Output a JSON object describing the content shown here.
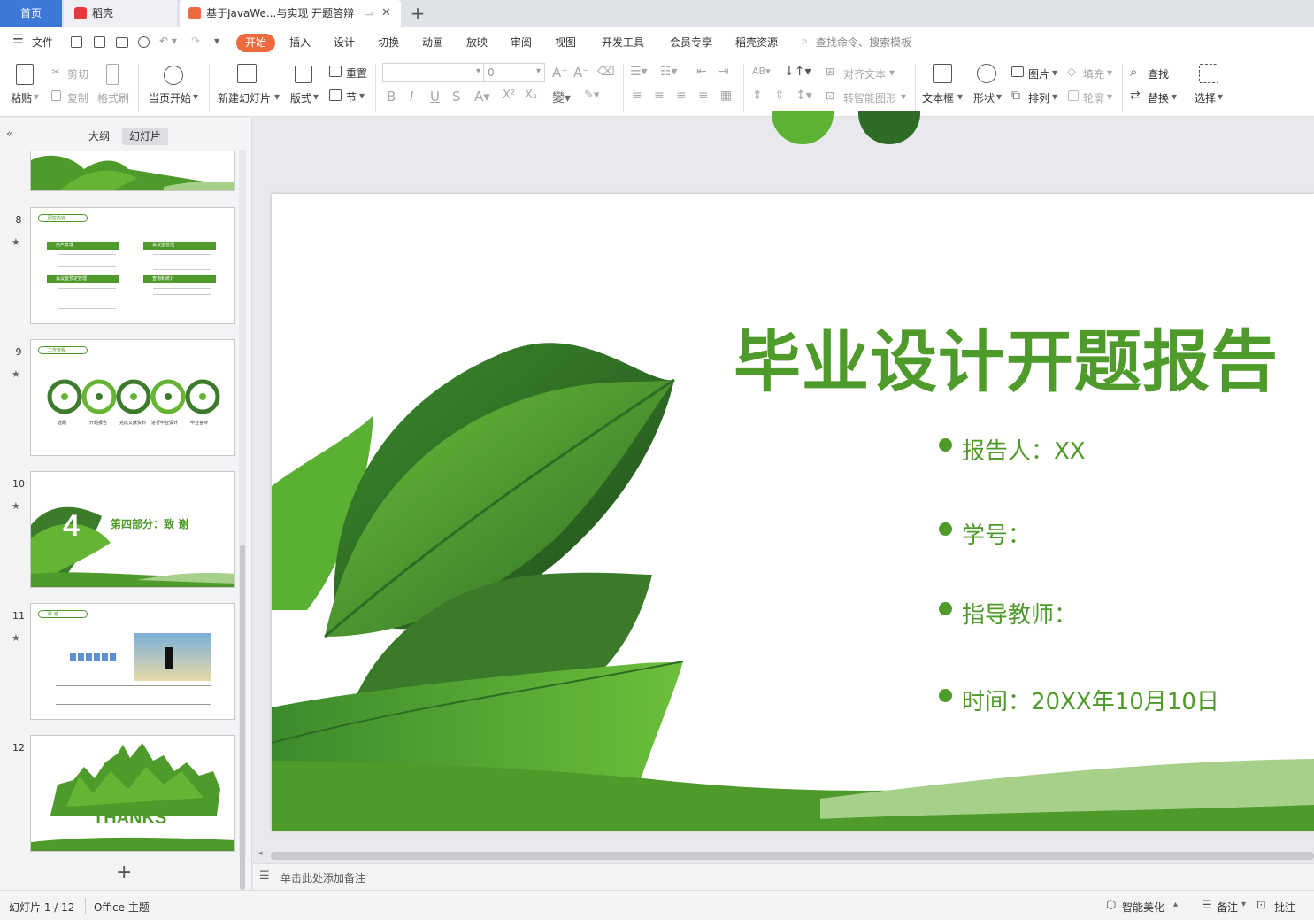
{
  "tabs": {
    "home": "首页",
    "daoke": "稻壳",
    "doc": "基于JavaWe...与实现 开题答辩",
    "add": "+"
  },
  "menu": {
    "file": "文件",
    "items": [
      "开始",
      "插入",
      "设计",
      "切换",
      "动画",
      "放映",
      "审阅",
      "视图",
      "开发工具",
      "会员专享",
      "稻壳资源"
    ],
    "search_placeholder": "查找命令、搜索模板"
  },
  "ribbon": {
    "paste": "粘贴",
    "cut": "剪切",
    "copy": "复制",
    "format_painter": "格式刷",
    "from_current": "当页开始",
    "new_slide": "新建幻灯片",
    "layout": "版式",
    "reset": "重置",
    "section": "节",
    "font_size": "0",
    "align_text": "对齐文本",
    "smart_shape": "转智能图形",
    "textbox": "文本框",
    "shape": "形状",
    "picture": "图片",
    "arrange": "排列",
    "fill": "填充",
    "outline": "轮廓",
    "find": "查找",
    "replace": "替换",
    "select": "选择"
  },
  "panel": {
    "outline_tab": "大纲",
    "slides_tab": "幻灯片",
    "add": "+"
  },
  "thumbnails": [
    {
      "num": "8",
      "header": "研究内容",
      "items": [
        "用户管理",
        "会议室管理",
        "会议室预定管理",
        "查询和统计"
      ]
    },
    {
      "num": "9",
      "header": "工作流程",
      "labels": [
        "选题",
        "开题报告",
        "完成文献资料",
        "进行毕业设计",
        "毕业答辩"
      ]
    },
    {
      "num": "10",
      "big_number": "4",
      "title": "第四部分：致 谢"
    },
    {
      "num": "11",
      "header": "致 谢"
    },
    {
      "num": "12",
      "thanks": "THANKS"
    }
  ],
  "slide": {
    "title": "毕业设计开题报告",
    "bullets": [
      "报告人：XX",
      "学号：",
      "指导教师：",
      "时间：20XX年10月10日"
    ]
  },
  "notes_placeholder": "单击此处添加备注",
  "status": {
    "slide_counter": "幻灯片 1 / 12",
    "theme": "Office 主题",
    "smart_beautify": "智能美化",
    "notes": "备注",
    "comments": "批注"
  },
  "colors": {
    "accent": "#3c78d8",
    "start_tab": "#ee6a3c",
    "title_green": "#4e9a2a",
    "leaf_dark": "#2e6b25",
    "leaf_light": "#66b434"
  }
}
